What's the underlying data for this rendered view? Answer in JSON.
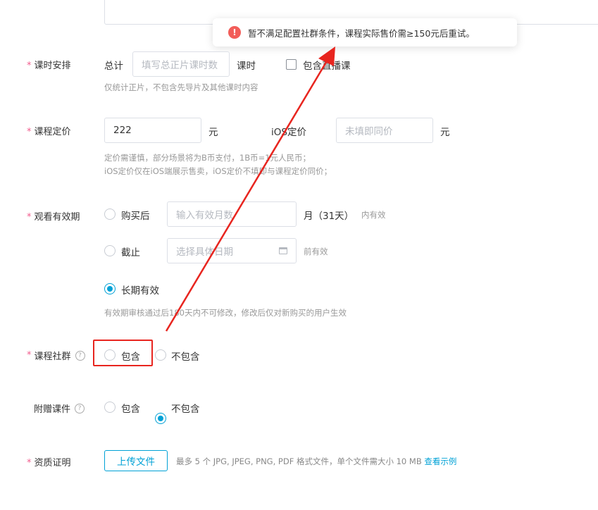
{
  "toast": {
    "icon": "error-icon",
    "message": "暂不满足配置社群条件，课程实际售价需≥150元后重试。"
  },
  "form": {
    "required_mark": "*",
    "schedule": {
      "label": "课时安排",
      "total_prefix": "总计",
      "input_placeholder": "填写总正片课时数",
      "unit": "课时",
      "include_live_label": "包含直播课",
      "hint": "仅统计正片，不包含先导片及其他课时内容"
    },
    "pricing": {
      "label": "课程定价",
      "price_value": "222",
      "currency": "元",
      "ios_label": "iOS定价",
      "ios_placeholder": "未填即同价",
      "ios_currency": "元",
      "hint_line1": "定价需谨慎，部分场景将为B币支付，1B币=1元人民币；",
      "hint_line2": "iOS定价仅在iOS端展示售卖，iOS定价不填即与课程定价同价；"
    },
    "validity": {
      "label": "观看有效期",
      "option_after_purchase": "购买后",
      "months_placeholder": "输入有效月数",
      "months_unit": "月（31天）",
      "months_suffix": "内有效",
      "option_until": "截止",
      "date_placeholder": "选择具体日期",
      "date_suffix": "前有效",
      "option_permanent": "长期有效",
      "hint": "有效期审核通过后180天内不可修改，修改后仅对新购买的用户生效"
    },
    "community": {
      "label": "课程社群",
      "option_include": "包含",
      "option_exclude": "不包含"
    },
    "courseware": {
      "label": "附赠课件",
      "option_include": "包含",
      "option_exclude": "不包含"
    },
    "qualification": {
      "label": "资质证明",
      "upload_button": "上传文件",
      "hint": "最多 5 个 JPG, JPEG, PNG, PDF 格式文件，单个文件需大小 10 MB",
      "example_link": "查看示例"
    }
  },
  "colors": {
    "accent": "#00a1d6",
    "required_star": "#f25d8e",
    "error": "#f25d59",
    "annotation": "#e8251f"
  }
}
